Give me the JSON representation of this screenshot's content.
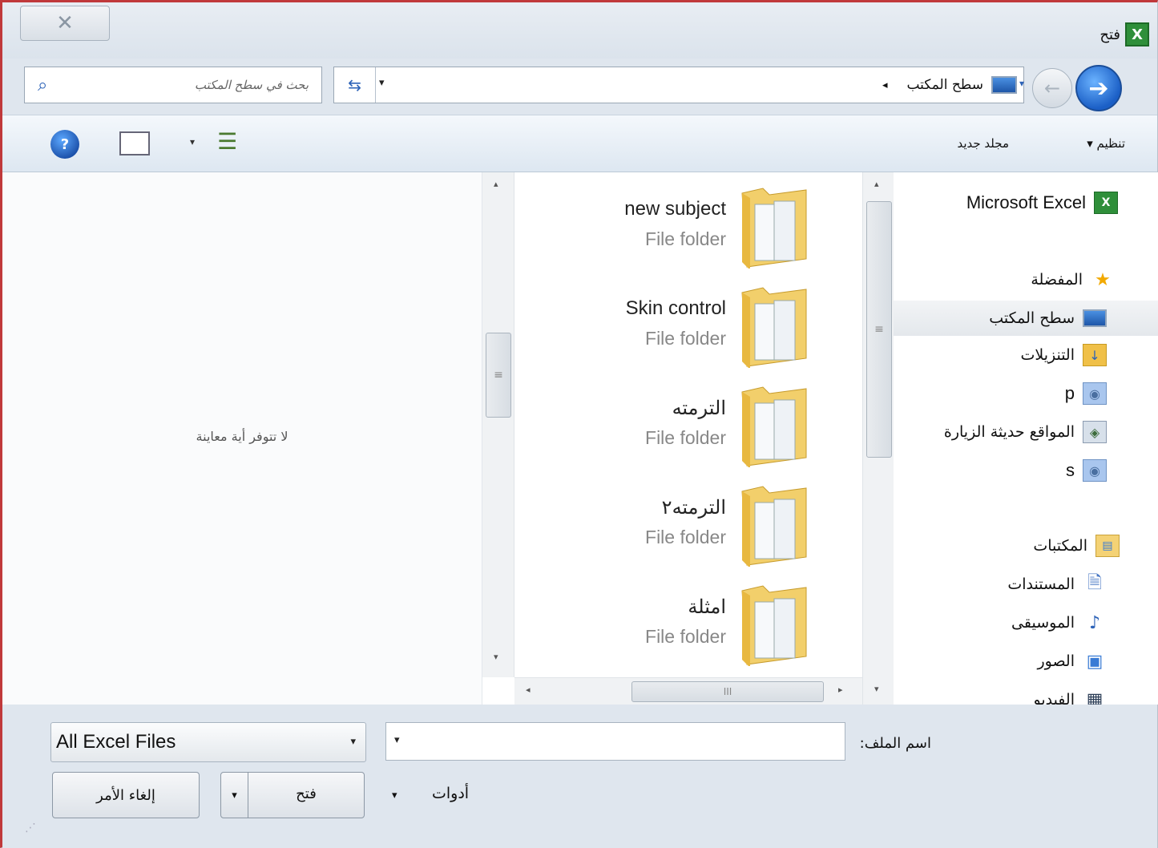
{
  "window": {
    "title": "فتح",
    "close_glyph": "✕",
    "app_icon_glyph": "X"
  },
  "address_bar": {
    "search_placeholder": "بحث في سطح المكتب",
    "search_icon": "search-icon",
    "refresh_glyph": "⇆",
    "dropdown_glyph": "▾",
    "path": [
      "سطح المكتب"
    ],
    "separator_glyph": "◂"
  },
  "navigation": {
    "back_glyph": "←",
    "forward_glyph": "➔",
    "history_glyph": "▾"
  },
  "toolbar": {
    "organize_label": "تنظيم ▾",
    "new_folder_label": "مجلد جديد",
    "view_arrow": "▾",
    "view_glyph": "☰",
    "help_glyph": "?"
  },
  "preview": {
    "empty_text": "لا تتوفر أية معاينة"
  },
  "files": [
    {
      "name": "new subject",
      "type": "File folder"
    },
    {
      "name": "Skin control",
      "type": "File folder"
    },
    {
      "name": "الترمته",
      "type": "File folder"
    },
    {
      "name": "الترمته٢",
      "type": "File folder"
    },
    {
      "name": "امثلة",
      "type": "File folder"
    }
  ],
  "scroll_glyphs": {
    "up": "▴",
    "down": "▾",
    "left": "◂",
    "right": "▸",
    "grip_v": "≡",
    "grip_h": "III"
  },
  "nav_pane": {
    "items": [
      {
        "label": "Microsoft Excel",
        "icon": "excel-icon",
        "glyph": "X"
      },
      {
        "label": "المفضلة",
        "icon": "star-icon",
        "glyph": "★"
      },
      {
        "label": "سطح المكتب",
        "icon": "desktop-icon",
        "glyph": ""
      },
      {
        "label": "التنزيلات",
        "icon": "downloads-folder-icon",
        "glyph": "↓"
      },
      {
        "label": "p",
        "icon": "user-folder-icon",
        "glyph": "◉"
      },
      {
        "label": "المواقع حديثة الزيارة",
        "icon": "recent-places-icon",
        "glyph": "◈"
      },
      {
        "label": "s",
        "icon": "user-folder-icon",
        "glyph": "◉"
      },
      {
        "label": "المكتبات",
        "icon": "libraries-icon",
        "glyph": "▤"
      },
      {
        "label": "المستندات",
        "icon": "documents-icon",
        "glyph": "🗎"
      },
      {
        "label": "الموسيقى",
        "icon": "music-icon",
        "glyph": "♪"
      },
      {
        "label": "الصور",
        "icon": "pictures-icon",
        "glyph": "▣"
      },
      {
        "label": "الفيديو",
        "icon": "video-icon",
        "glyph": "▦"
      }
    ]
  },
  "bottom": {
    "filename_label": "اسم الملف:",
    "filename_value": "",
    "filename_arrow": "▾",
    "filetype_value": "All Excel Files",
    "filetype_arrow": "▾",
    "tools_label": "أدوات",
    "tools_arrow": "▾",
    "open_label": "فتح",
    "open_arrow": "▾",
    "cancel_label": "إلغاء الأمر",
    "grip_glyph": "⋰"
  }
}
